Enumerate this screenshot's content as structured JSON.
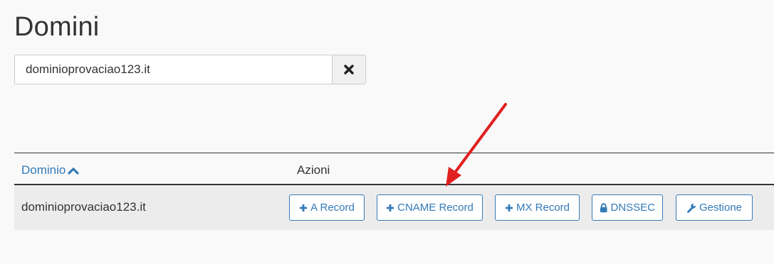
{
  "page": {
    "title": "Domini"
  },
  "search": {
    "value": "dominioprovaciao123.it",
    "clear_icon": "times-icon"
  },
  "table": {
    "headers": {
      "domain": "Dominio",
      "domain_sort_icon": "chevron-up-icon",
      "actions": "Azioni"
    },
    "rows": [
      {
        "domain": "dominioprovaciao123.it",
        "actions": [
          {
            "label": "A Record",
            "icon": "plus-icon"
          },
          {
            "label": "CNAME Record",
            "icon": "plus-icon"
          },
          {
            "label": "MX Record",
            "icon": "plus-icon"
          },
          {
            "label": "DNSSEC",
            "icon": "lock-icon"
          },
          {
            "label": "Gestione",
            "icon": "wrench-icon"
          }
        ]
      }
    ]
  },
  "annotation": {
    "type": "red-arrow",
    "points_to": "CNAME Record",
    "color": "#e02020"
  },
  "colors": {
    "link": "#337ab7",
    "text": "#333333",
    "background": "#f9f9f9",
    "row_background": "#ececec"
  }
}
